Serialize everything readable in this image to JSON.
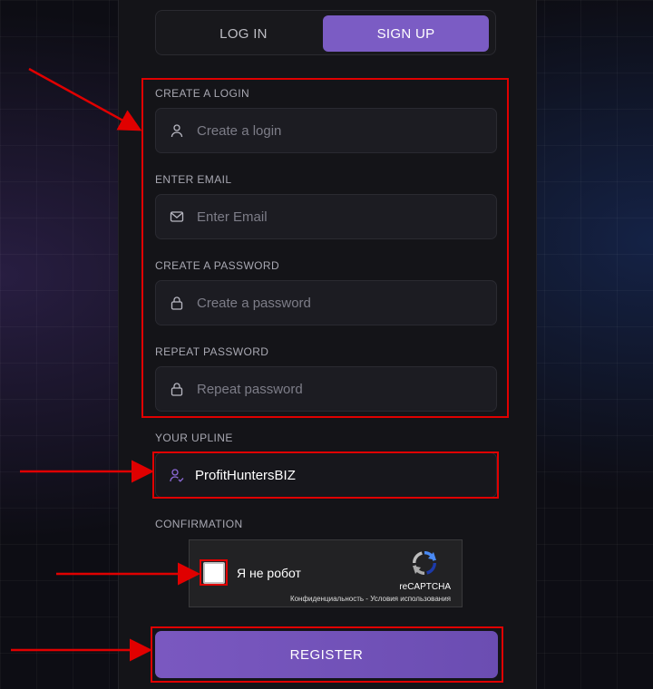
{
  "tabs": {
    "login_label": "LOG IN",
    "signup_label": "SIGN UP",
    "active": "SIGN UP"
  },
  "form": {
    "login": {
      "label": "CREATE A LOGIN",
      "placeholder": "Create a login",
      "value": ""
    },
    "email": {
      "label": "ENTER EMAIL",
      "placeholder": "Enter Email",
      "value": ""
    },
    "password": {
      "label": "CREATE A PASSWORD",
      "placeholder": "Create a password",
      "value": ""
    },
    "repeat_password": {
      "label": "REPEAT PASSWORD",
      "placeholder": "Repeat password",
      "value": ""
    },
    "upline": {
      "label": "YOUR UPLINE",
      "value": "ProfitHuntersBIZ"
    }
  },
  "confirmation": {
    "label": "CONFIRMATION",
    "captcha_text": "Я не робот",
    "captcha_brand": "reCAPTCHA",
    "captcha_links": "Конфиденциальность - Условия использования",
    "checked": false
  },
  "register_label": "REGISTER",
  "colors": {
    "accent": "#7b5cc4",
    "annotation": "#e00000",
    "background": "#0d0d14",
    "panel": "#141418"
  },
  "icons": {
    "login": "user-icon",
    "email": "mail-icon",
    "password": "lock-icon",
    "repeat_password": "lock-icon",
    "upline": "user-check-icon",
    "captcha": "recaptcha-logo-icon"
  }
}
